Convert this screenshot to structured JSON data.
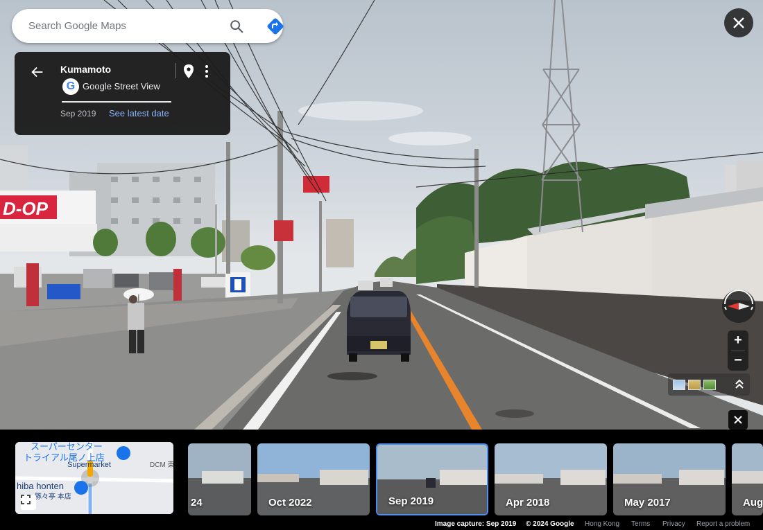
{
  "search": {
    "placeholder": "Search Google Maps"
  },
  "icons": {
    "search": "search-icon",
    "directions": "directions-icon",
    "back": "back-arrow-icon",
    "pin": "pin-icon",
    "more": "more-vert-icon",
    "close": "close-icon",
    "compass": "compass-icon",
    "fullscreen": "fullscreen-icon",
    "expand": "expand-icon"
  },
  "card": {
    "title": "Kumamoto",
    "logo_letter": "G",
    "subtitle": "Google Street View",
    "date": "Sep 2019",
    "latest_link": "See latest date"
  },
  "zoom": {
    "in": "+",
    "out": "−"
  },
  "scene_signs": {
    "store_sign": "D-OP"
  },
  "minimap": {
    "labels": [
      "スーパーセンター",
      "トライアル尾ノ上店",
      "Supermarket",
      "DCM 東",
      "hiba honten",
      "豚々亭 本店"
    ]
  },
  "timeline": [
    {
      "label": "24",
      "selected": false
    },
    {
      "label": "Oct 2022",
      "selected": false
    },
    {
      "label": "Sep 2019",
      "selected": true
    },
    {
      "label": "Apr 2018",
      "selected": false
    },
    {
      "label": "May 2017",
      "selected": false
    },
    {
      "label": "Aug",
      "selected": false
    }
  ],
  "footer": {
    "capture": "Image capture: Sep 2019",
    "copyright": "© 2024 Google",
    "region": "Hong Kong",
    "terms": "Terms",
    "privacy": "Privacy",
    "report": "Report a problem"
  },
  "colors": {
    "accent": "#4a8ef0",
    "link": "#8ab4f8",
    "directions": "#1a73e8"
  }
}
